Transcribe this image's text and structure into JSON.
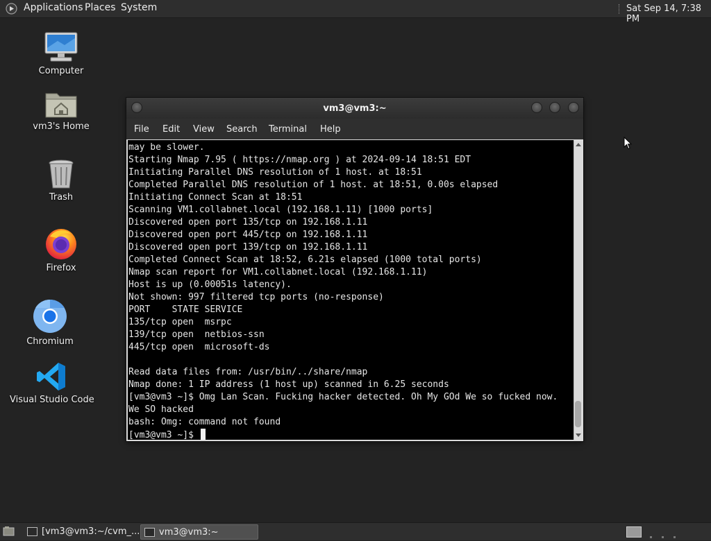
{
  "top_panel": {
    "menus": [
      "Applications",
      "Places",
      "System"
    ],
    "clock": "Sat Sep 14,  7:38 PM"
  },
  "desktop": {
    "icons": [
      {
        "label": "Computer",
        "icon": "computer-icon"
      },
      {
        "label": "vm3's Home",
        "icon": "home-folder-icon"
      },
      {
        "label": "Trash",
        "icon": "trash-icon"
      },
      {
        "label": "Firefox",
        "icon": "firefox-icon"
      },
      {
        "label": "Chromium",
        "icon": "chromium-icon"
      },
      {
        "label": "Visual Studio Code",
        "icon": "vscode-icon"
      }
    ]
  },
  "terminal": {
    "title": "vm3@vm3:~",
    "menu": [
      "File",
      "Edit",
      "View",
      "Search",
      "Terminal",
      "Help"
    ],
    "lines": [
      "may be slower.",
      "Starting Nmap 7.95 ( https://nmap.org ) at 2024-09-14 18:51 EDT",
      "Initiating Parallel DNS resolution of 1 host. at 18:51",
      "Completed Parallel DNS resolution of 1 host. at 18:51, 0.00s elapsed",
      "Initiating Connect Scan at 18:51",
      "Scanning VM1.collabnet.local (192.168.1.11) [1000 ports]",
      "Discovered open port 135/tcp on 192.168.1.11",
      "Discovered open port 445/tcp on 192.168.1.11",
      "Discovered open port 139/tcp on 192.168.1.11",
      "Completed Connect Scan at 18:52, 6.21s elapsed (1000 total ports)",
      "Nmap scan report for VM1.collabnet.local (192.168.1.11)",
      "Host is up (0.00051s latency).",
      "Not shown: 997 filtered tcp ports (no-response)",
      "PORT    STATE SERVICE",
      "135/tcp open  msrpc",
      "139/tcp open  netbios-ssn",
      "445/tcp open  microsoft-ds",
      "",
      "Read data files from: /usr/bin/../share/nmap",
      "Nmap done: 1 IP address (1 host up) scanned in 6.25 seconds",
      "[vm3@vm3 ~]$ Omg Lan Scan. Fucking hacker detected. Oh My GOd We so fucked now.",
      "We SO hacked",
      "bash: Omg: command not found"
    ],
    "prompt": "[vm3@vm3 ~]$ "
  },
  "taskbar": {
    "tasks": [
      {
        "label": "[vm3@vm3:~/cvm_..."
      },
      {
        "label": "vm3@vm3:~"
      }
    ]
  }
}
